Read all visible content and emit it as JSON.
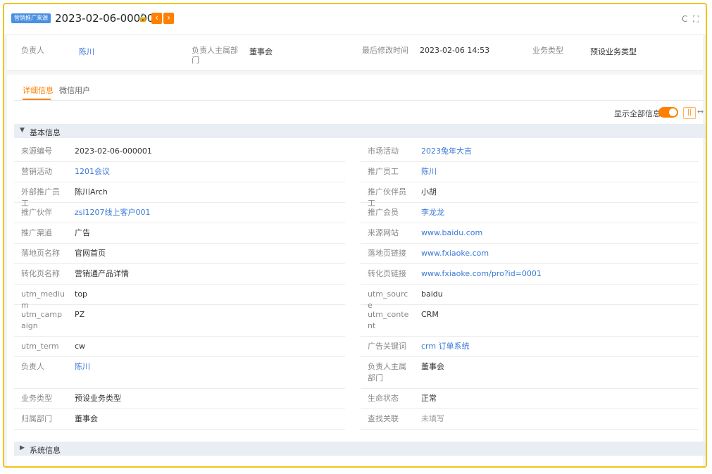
{
  "header": {
    "tag": "营销推广来源",
    "title": "2023-02-06-000001",
    "prev_label": "‹",
    "next_label": "›",
    "refresh_icon": "C",
    "expand_icon": "⛶"
  },
  "summary": [
    {
      "label": "负责人",
      "value": "陈川",
      "link": true
    },
    {
      "label": "负责人主属部门",
      "value": "董事会",
      "link": false
    },
    {
      "label": "最后修改时间",
      "value": "2023-02-06 14:53",
      "link": false
    },
    {
      "label": "业务类型",
      "value": "预设业务类型",
      "link": false
    }
  ],
  "tabs": [
    "详细信息",
    "微信用户"
  ],
  "toolbar": {
    "show_all_label": "显示全部信息",
    "show_all_on": true,
    "column_icon": "||",
    "expand_icon": "↔"
  },
  "section_basic": {
    "title": "基本信息",
    "arrow": "▼"
  },
  "fields_left": [
    {
      "label": "来源编号",
      "value": "2023-02-06-000001",
      "link": false
    },
    {
      "label": "营销活动",
      "value": "1201会议",
      "link": true
    },
    {
      "label": "外部推广员工",
      "value": "陈川Arch",
      "link": false
    },
    {
      "label": "推广伙伴",
      "value": "zsl1207线上客户001",
      "link": true
    },
    {
      "label": "推广渠道",
      "value": "广告",
      "link": false
    },
    {
      "label": "落地页名称",
      "value": "官网首页",
      "link": false
    },
    {
      "label": "转化页名称",
      "value": "营销通产品详情",
      "link": false
    },
    {
      "label": "utm_medium",
      "value": "top",
      "link": false
    },
    {
      "label": "utm_campaign",
      "value": "PZ",
      "link": false
    },
    {
      "label": "utm_term",
      "value": "cw",
      "link": false
    },
    {
      "label": "负责人",
      "value": "陈川",
      "link": true
    },
    {
      "label": "业务类型",
      "value": "预设业务类型",
      "link": false
    },
    {
      "label": "归属部门",
      "value": "董事会",
      "link": false
    }
  ],
  "fields_right": [
    {
      "label": "市场活动",
      "value": "2023兔年大吉",
      "link": true
    },
    {
      "label": "推广员工",
      "value": "陈川",
      "link": true
    },
    {
      "label": "推广伙伴员工",
      "value": "小胡",
      "link": false
    },
    {
      "label": "推广会员",
      "value": "李龙龙",
      "link": true
    },
    {
      "label": "来源网站",
      "value": "www.baidu.com",
      "link": true
    },
    {
      "label": "落地页链接",
      "value": "www.fxiaoke.com",
      "link": true
    },
    {
      "label": "转化页链接",
      "value": "www.fxiaoke.com/pro?id=0001",
      "link": true
    },
    {
      "label": "utm_source",
      "value": "baidu",
      "link": false
    },
    {
      "label": "utm_content",
      "value": "CRM",
      "link": false
    },
    {
      "label": "广告关键词",
      "value": "crm 订单系统",
      "link": true
    },
    {
      "label": "负责人主属部门",
      "value": "董事会",
      "link": false
    },
    {
      "label": "生命状态",
      "value": "正常",
      "link": false
    },
    {
      "label": "查找关联",
      "value": "未填写",
      "link": false,
      "muted": true
    }
  ],
  "section_system": {
    "title": "系统信息",
    "arrow": "▶"
  }
}
